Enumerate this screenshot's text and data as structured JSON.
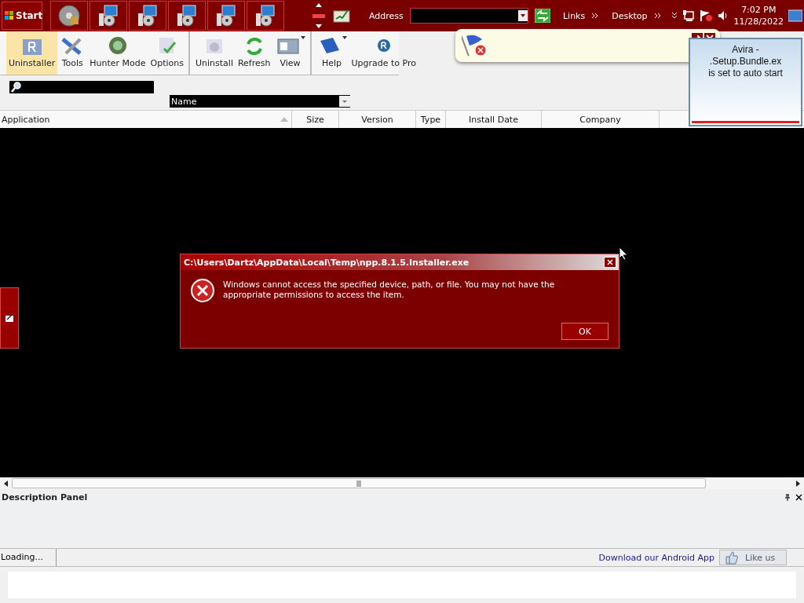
{
  "taskbar": {
    "start_label": "Start",
    "tasks": [
      {
        "kind": "disc"
      },
      {
        "kind": "installer"
      },
      {
        "kind": "installer"
      },
      {
        "kind": "installer"
      },
      {
        "kind": "installer"
      },
      {
        "kind": "installer"
      }
    ],
    "address_label": "Address",
    "links_label": "Links",
    "desktop_label": "Desktop",
    "time": "7:02 PM",
    "date": "11/28/2022"
  },
  "ribbon": {
    "buttons": [
      {
        "label": "Uninstaller",
        "kind": "box",
        "selected": true,
        "dropdown": false,
        "group_end": false
      },
      {
        "label": "Tools",
        "kind": "tools",
        "selected": false,
        "dropdown": false,
        "group_end": false
      },
      {
        "label": "Hunter Mode",
        "kind": "target",
        "selected": false,
        "dropdown": false,
        "group_end": false
      },
      {
        "label": "Options",
        "kind": "options",
        "selected": false,
        "dropdown": false,
        "group_end": true
      },
      {
        "label": "Uninstall",
        "kind": "remove",
        "selected": false,
        "dropdown": false,
        "group_end": false
      },
      {
        "label": "Refresh",
        "kind": "refresh",
        "selected": false,
        "dropdown": false,
        "group_end": false
      },
      {
        "label": "View",
        "kind": "view",
        "selected": false,
        "dropdown": true,
        "group_end": true
      },
      {
        "label": "Help",
        "kind": "book",
        "selected": false,
        "dropdown": true,
        "group_end": false
      },
      {
        "label": "Upgrade to Pro",
        "kind": "badge",
        "selected": false,
        "dropdown": false,
        "group_end": false
      }
    ]
  },
  "filter": {
    "sort_value": "Name"
  },
  "table": {
    "columns": [
      {
        "label": "Application",
        "sorted": true
      },
      {
        "label": "Size",
        "sorted": false
      },
      {
        "label": "Version",
        "sorted": false
      },
      {
        "label": "Type",
        "sorted": false
      },
      {
        "label": "Install Date",
        "sorted": false
      },
      {
        "label": "Company",
        "sorted": false
      }
    ]
  },
  "dialog": {
    "title": "C:\\Users\\Dartz\\AppData\\Local\\Temp\\npp.8.1.5.Installer.exe",
    "message": "Windows cannot access the specified device, path, or file.  You may not have the appropriate permissions to access the item.",
    "ok": "OK"
  },
  "notification": {
    "lines": [
      "Avira -",
      ".Setup.Bundle.ex",
      "is set to auto start"
    ]
  },
  "description_panel": {
    "title": "Description Panel"
  },
  "status_bar": {
    "text": "Loading...",
    "link": "Download our Android App",
    "like": "Like us"
  }
}
